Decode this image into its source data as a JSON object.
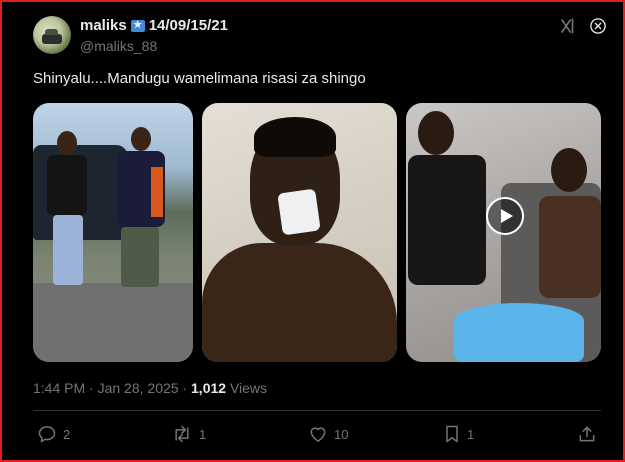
{
  "author": {
    "display_name": "maliks",
    "name_suffix": "14/09/15/21",
    "handle": "@maliks_88",
    "flag_icon": "somalia-flag-icon"
  },
  "post": {
    "text": "Shinyalu....Mandugu wamelimana risasi za shingo",
    "time": "1:44 PM",
    "separator": "·",
    "date": "Jan 28, 2025",
    "views_count": "1,012",
    "views_label": "Views"
  },
  "media": [
    {
      "kind": "photo",
      "subject": "two men standing by car"
    },
    {
      "kind": "photo",
      "subject": "man with bandaged neck"
    },
    {
      "kind": "video",
      "subject": "man treating injured man"
    }
  ],
  "actions": {
    "reply_count": "2",
    "repost_count": "1",
    "like_count": "10",
    "bookmark_count": "1"
  },
  "colors": {
    "background": "#000000",
    "frame": "#e0201b",
    "text": "#e7e9ea",
    "muted": "#71767b",
    "divider": "#2f3336"
  }
}
